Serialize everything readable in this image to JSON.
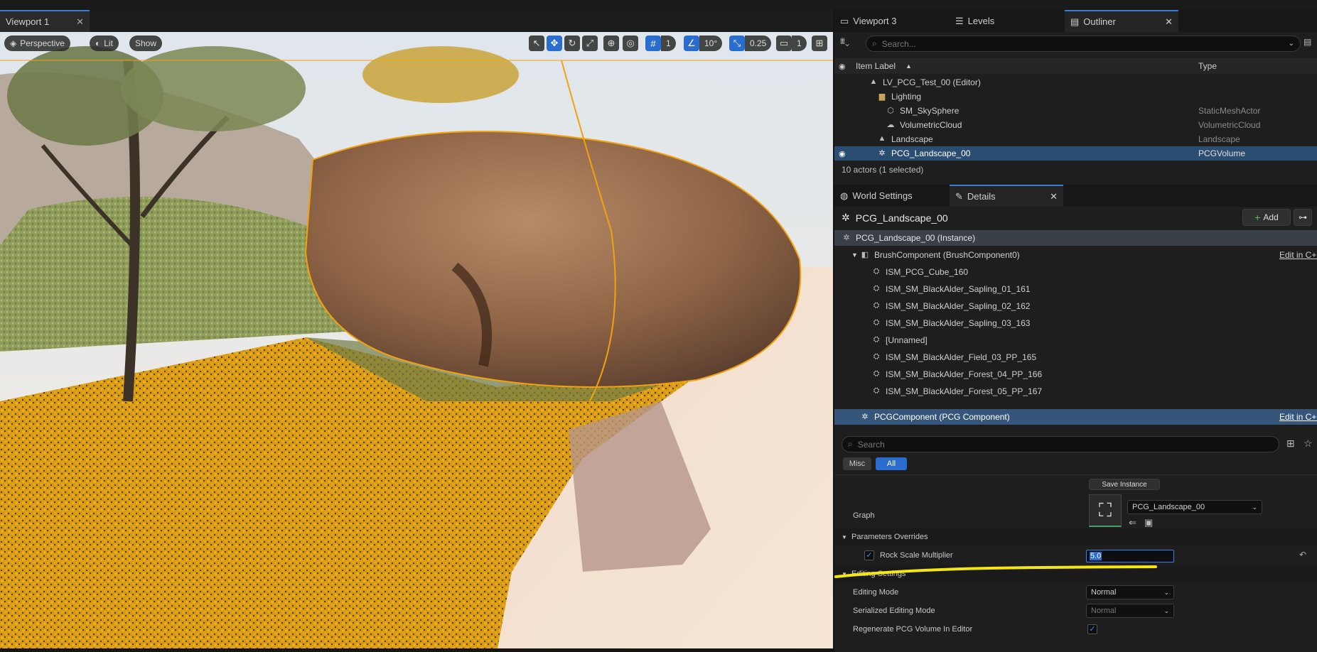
{
  "viewport": {
    "tab_label": "Viewport 1",
    "perspective_label": "Perspective",
    "lit_label": "Lit",
    "show_label": "Show",
    "grid_value": "1",
    "angle_value": "10°",
    "scale_value": "0.25",
    "camera_value": "1"
  },
  "outliner": {
    "tabs": [
      {
        "label": "Viewport 3"
      },
      {
        "label": "Levels"
      },
      {
        "label": "Outliner"
      }
    ],
    "search_placeholder": "Search...",
    "col_label": "Item Label",
    "col_type": "Type",
    "rows": [
      {
        "label": "LV_PCG_Test_00 (Editor)",
        "type": ""
      },
      {
        "label": "Lighting",
        "type": ""
      },
      {
        "label": "SM_SkySphere",
        "type": "StaticMeshActor"
      },
      {
        "label": "VolumetricCloud",
        "type": "VolumetricCloud"
      },
      {
        "label": "Landscape",
        "type": "Landscape"
      },
      {
        "label": "PCG_Landscape_00",
        "type": "PCGVolume"
      }
    ],
    "status": "10 actors (1 selected)"
  },
  "details": {
    "tabs": [
      {
        "label": "World Settings"
      },
      {
        "label": "Details"
      }
    ],
    "actor_name": "PCG_Landscape_00",
    "add_label": "Add",
    "instance_label": "PCG_Landscape_00 (Instance)",
    "brush_component": "BrushComponent (BrushComponent0)",
    "edit_cpp": "Edit in C++",
    "components": [
      {
        "label": "ISM_PCG_Cube_160"
      },
      {
        "label": "ISM_SM_BlackAlder_Sapling_01_161"
      },
      {
        "label": "ISM_SM_BlackAlder_Sapling_02_162"
      },
      {
        "label": "ISM_SM_BlackAlder_Sapling_03_163"
      },
      {
        "label": "[Unnamed]"
      },
      {
        "label": "ISM_SM_BlackAlder_Field_03_PP_165"
      },
      {
        "label": "ISM_SM_BlackAlder_Forest_04_PP_166"
      },
      {
        "label": "ISM_SM_BlackAlder_Forest_05_PP_167"
      }
    ],
    "pcg_component": "PCGComponent (PCG Component)",
    "search_placeholder": "Search",
    "filter_misc": "Misc",
    "filter_all": "All",
    "save_instance": "Save Instance",
    "graph_label": "Graph",
    "graph_value": "PCG_Landscape_00",
    "param_overrides": "Parameters Overrides",
    "rock_scale_label": "Rock Scale Multiplier",
    "rock_scale_value": "5.0",
    "rock_scale_enabled": true,
    "editing_settings": "Editing Settings",
    "editing_mode_label": "Editing Mode",
    "editing_mode_value": "Normal",
    "serialized_mode_label": "Serialized Editing Mode",
    "serialized_mode_value": "Normal",
    "regen_label": "Regenerate PCG Volume In Editor",
    "regen_checked": true
  },
  "colors": {
    "selection": "#2b4d72",
    "accent_blue": "#2b6ccf",
    "highlight_outline": "#f2a20e",
    "annotation_yellow": "#f4e612"
  }
}
